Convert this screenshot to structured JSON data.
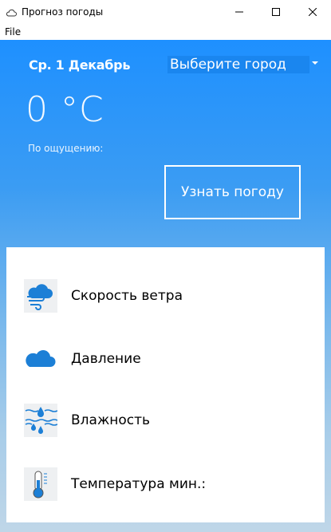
{
  "window": {
    "title": "Прогноз погоды",
    "icon": "cloud-icon"
  },
  "menu": {
    "file": "File"
  },
  "header": {
    "date": "Ср. 1 Декабрь",
    "city_placeholder": "Выберите город",
    "temperature": "0 °C",
    "feels_like": "По ощущению:",
    "get_weather_button": "Узнать погоду"
  },
  "details": [
    {
      "label": "Скорость ветра",
      "icon": "wind-icon"
    },
    {
      "label": "Давление",
      "icon": "cloud-icon"
    },
    {
      "label": "Влажность",
      "icon": "humidity-icon"
    },
    {
      "label": "Температура мин.:",
      "icon": "thermometer-icon"
    }
  ],
  "colors": {
    "accent_blue": "#1e90ff",
    "select_bg": "#1a86ef",
    "icon_blue": "#1c7fd6"
  }
}
